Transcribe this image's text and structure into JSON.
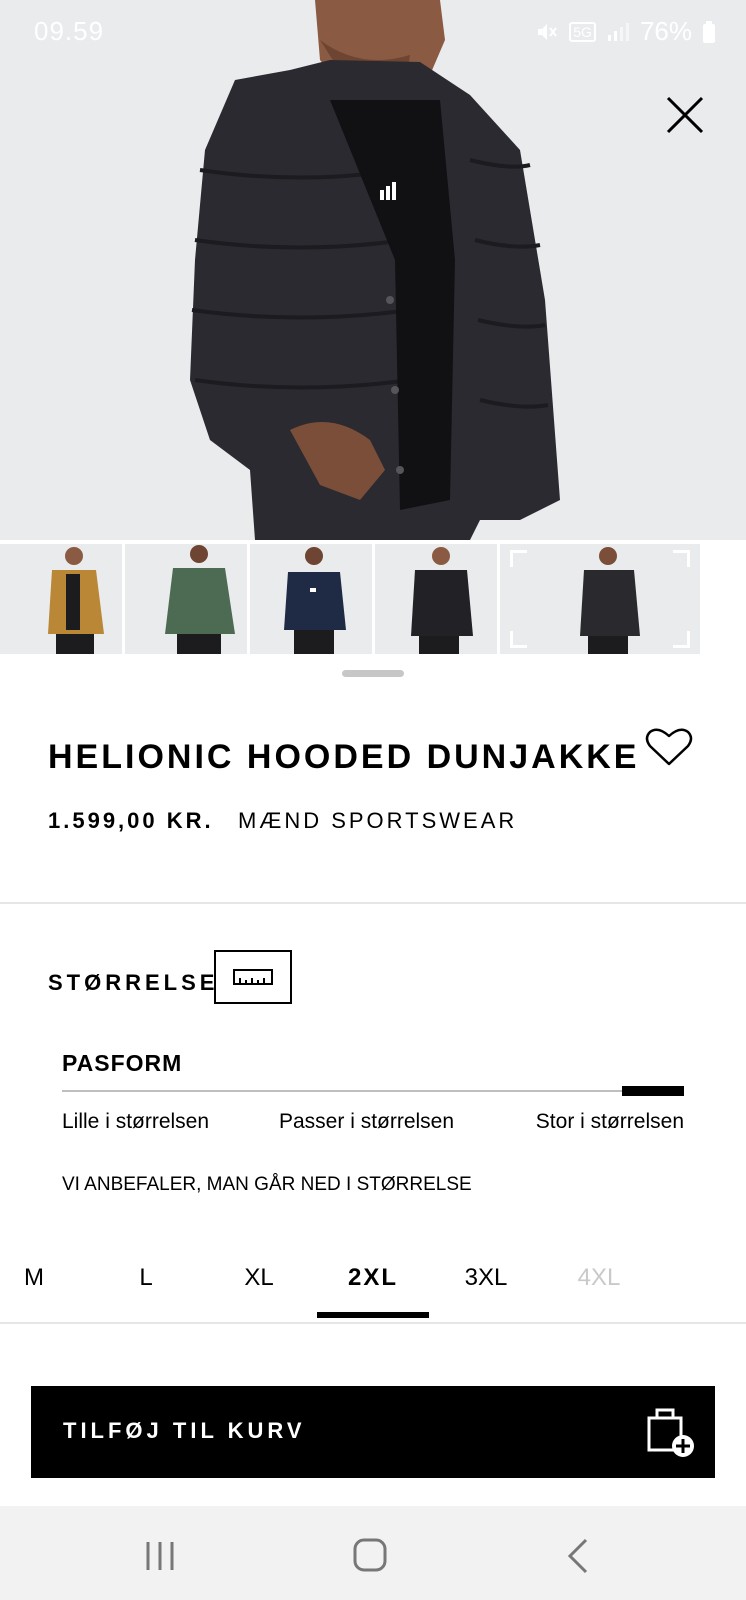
{
  "status": {
    "time": "09.59",
    "network": "5G",
    "battery": "76%"
  },
  "product": {
    "title": "HELIONIC HOODED DUNJAKKE",
    "price": "1.599,00 KR.",
    "category": "MÆND SPORTSWEAR"
  },
  "thumbnails": [
    {
      "name": "mustard",
      "color": "#b98735"
    },
    {
      "name": "green",
      "color": "#4c6b52"
    },
    {
      "name": "navy",
      "color": "#1f2a44"
    },
    {
      "name": "black-1",
      "color": "#222226"
    },
    {
      "name": "black-2",
      "color": "#2a2a2e",
      "selected": true
    }
  ],
  "size": {
    "label": "STØRRELSE",
    "fit_title": "PASFORM",
    "fit_low": "Lille i størrelsen",
    "fit_mid": "Passer i størrelsen",
    "fit_high": "Stor i størrelsen",
    "fit_position": 1.0,
    "fit_note": "VI ANBEFALER, MAN GÅR NED I STØRRELSE",
    "options": [
      {
        "label": "M"
      },
      {
        "label": "L"
      },
      {
        "label": "XL"
      },
      {
        "label": "2XL",
        "selected": true
      },
      {
        "label": "3XL"
      },
      {
        "label": "4XL",
        "disabled": true
      }
    ]
  },
  "cart": {
    "add_label": "TILFØJ TIL KURV"
  },
  "colors": {
    "hero_bg": "#eaebed",
    "primary": "#000000",
    "disabled": "#c9c9c9"
  },
  "icons": {
    "close": "close-icon",
    "heart": "heart-icon",
    "ruler": "ruler-icon",
    "bag": "shopping-bag-add-icon",
    "nav_recent": "recent-apps-icon",
    "nav_home": "home-icon",
    "nav_back": "back-icon"
  }
}
